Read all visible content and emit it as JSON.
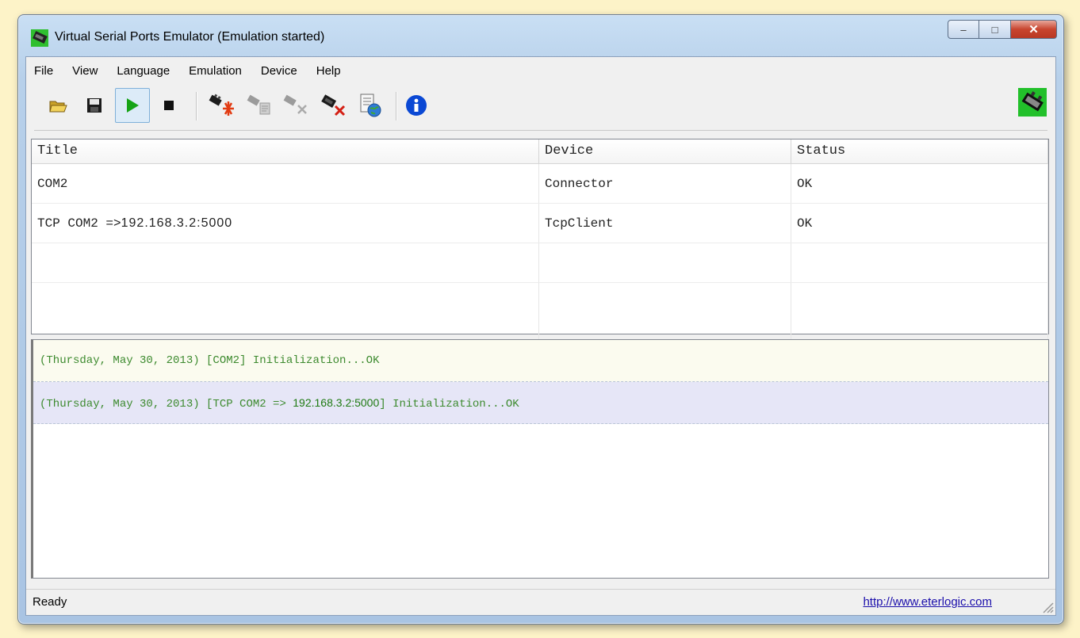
{
  "window": {
    "title": "Virtual Serial Ports Emulator (Emulation started)",
    "min_glyph": "–",
    "max_glyph": "□",
    "close_glyph": "✕"
  },
  "menu": [
    "File",
    "View",
    "Language",
    "Emulation",
    "Device",
    "Help"
  ],
  "toolbar": {
    "buttons": [
      {
        "name": "open-icon",
        "enabled": true
      },
      {
        "name": "save-icon",
        "enabled": true
      },
      {
        "name": "play-icon",
        "enabled": true,
        "pressed": true
      },
      {
        "name": "stop-icon",
        "enabled": true
      },
      {
        "name": "new-device-icon",
        "enabled": true
      },
      {
        "name": "device-properties-icon",
        "enabled": false
      },
      {
        "name": "delete-device-icon",
        "enabled": false
      },
      {
        "name": "remove-all-devices-icon",
        "enabled": true
      },
      {
        "name": "export-globe-icon",
        "enabled": true
      },
      {
        "name": "info-icon",
        "enabled": true
      }
    ]
  },
  "grid": {
    "headers": [
      "Title",
      "Device",
      "Status"
    ],
    "rows": [
      {
        "title": "COM2",
        "title_ip": "",
        "device": "Connector",
        "status": "OK"
      },
      {
        "title": "TCP COM2 =>",
        "title_ip": "192.168.3.2:5000",
        "device": "TcpClient",
        "status": "OK"
      }
    ]
  },
  "log": [
    {
      "prefix": "(Thursday, May 30, 2013) [COM2] Initialization...OK",
      "ip": "",
      "suffix": ""
    },
    {
      "prefix": "(Thursday, May 30, 2013) [TCP COM2 => ",
      "ip": "192.168.3.2:5000",
      "suffix": "] Initialization...OK"
    }
  ],
  "status": {
    "text": "Ready",
    "link": "http://www.eterlogic.com"
  },
  "colors": {
    "log_text": "#3c8a2e",
    "log_row1_bg": "#fbfbef",
    "log_row2_bg": "#e6e6f7",
    "link": "#1a0dab"
  }
}
